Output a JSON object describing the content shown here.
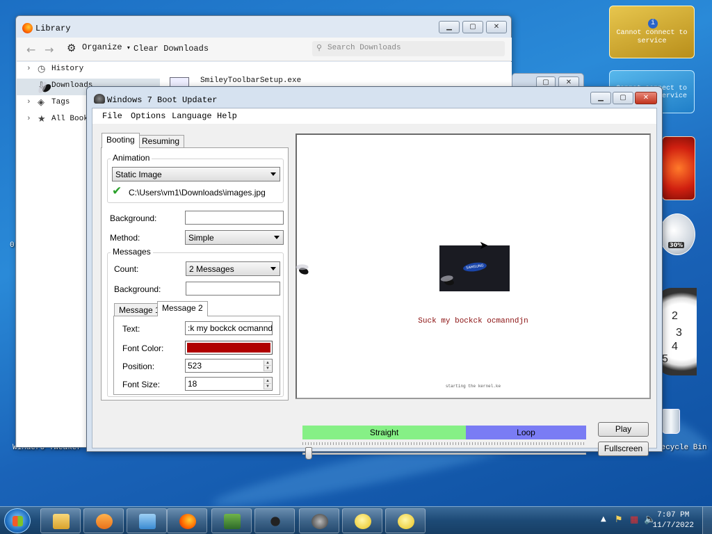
{
  "desktop": {
    "labels": {
      "winaero": "Winaero Tweaker",
      "recycle": "Recycle Bin",
      "stray_zero": "0"
    },
    "gadgets": {
      "currency_msg": "Cannot connect to service",
      "weather_msg": "Cannot connect to service",
      "meter_pct": "30%",
      "clock_numbers": [
        "2",
        "3",
        "4",
        "5"
      ]
    }
  },
  "library": {
    "title": "Library",
    "toolbar": {
      "organize": "Organize",
      "clear": "Clear Downloads",
      "search_placeholder": "Search Downloads"
    },
    "sidebar": [
      {
        "label": "History",
        "icon": "clock-icon"
      },
      {
        "label": "Downloads",
        "icon": "download-icon",
        "selected": true
      },
      {
        "label": "Tags",
        "icon": "tag-icon"
      },
      {
        "label": "All Bookmarks",
        "icon": "star-icon"
      }
    ],
    "downloads": [
      {
        "name": "SmileyToolbarSetup.exe"
      }
    ]
  },
  "boot_updater": {
    "title": "Windows 7 Boot Updater",
    "menu": [
      "File",
      "Options",
      "Language",
      "Help"
    ],
    "tabs": {
      "booting": "Booting",
      "resuming": "Resuming"
    },
    "animation": {
      "legend": "Animation",
      "type": "Static Image",
      "file": "C:\\Users\\vm1\\Downloads\\images.jpg"
    },
    "background_label": "Background:",
    "background_value": "",
    "method_label": "Method:",
    "method_value": "Simple",
    "messages": {
      "legend": "Messages",
      "count_label": "Count:",
      "count_value": "2 Messages",
      "background_label": "Background:",
      "background_value": "",
      "tabs": [
        "Message 1",
        "Message 2"
      ],
      "active_tab": "Message 2",
      "text_label": "Text:",
      "text_value": "Suck my bockck ocmanndjn",
      "text_visible": ":k my bockck ocmanndjn",
      "font_color_label": "Font Color:",
      "font_color": "#b00000",
      "position_label": "Position:",
      "position_value": "523",
      "font_size_label": "Font Size:",
      "font_size_value": "18"
    },
    "preview": {
      "logo_text": "SAMSUNG",
      "message1": "Suck my bockck ocmanndjn",
      "message2": "starting the kernel.ke"
    },
    "timeline": {
      "straight": "Straight",
      "loop": "Loop",
      "straight_color": "#86f086",
      "loop_color": "#7a7cf4",
      "position": 0.0
    },
    "buttons": {
      "play": "Play",
      "fullscreen": "Fullscreen"
    }
  },
  "taskbar": {
    "clock_time": "7:07 PM",
    "clock_date": "11/7/2022",
    "pinned": [
      "explorer-icon",
      "media-player-icon",
      "control-panel-icon",
      "firefox-icon",
      "remote-desktop-icon",
      "fly-icon",
      "boot-updater-icon",
      "smiley-icon",
      "smiley-icon"
    ]
  }
}
